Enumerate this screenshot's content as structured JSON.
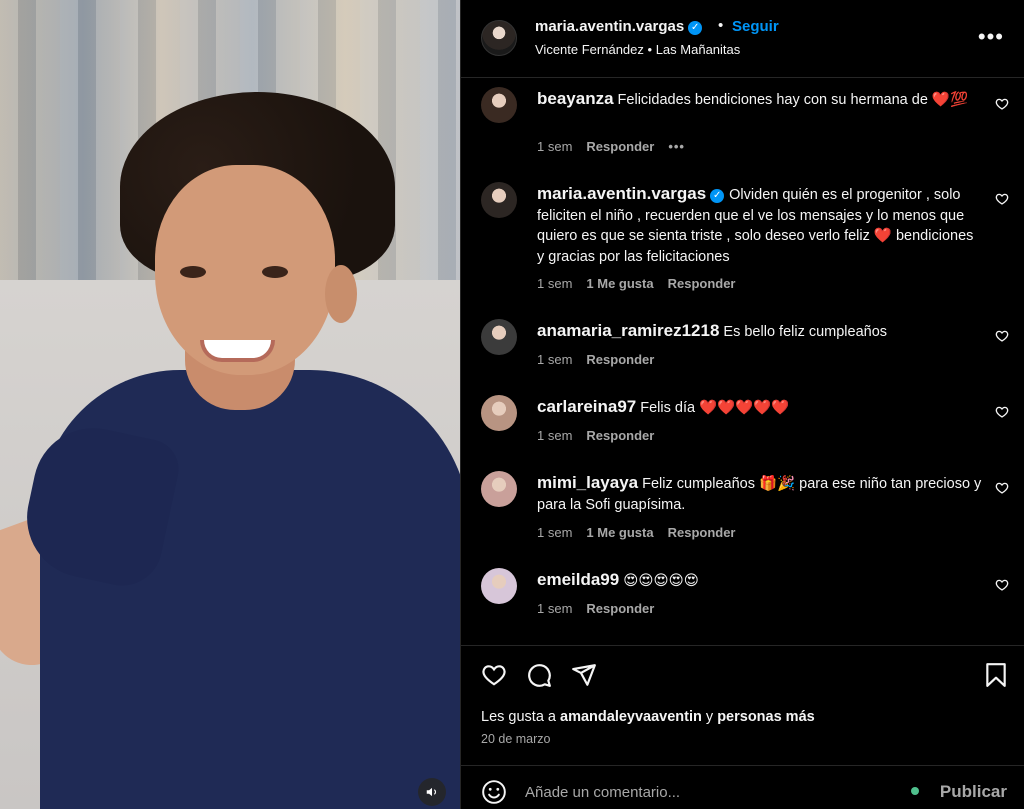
{
  "photo": {
    "sound_icon": "speaker-icon"
  },
  "header": {
    "owner_username": "maria.aventin.vargas",
    "separator": "•",
    "follow_label": "Seguir",
    "audio_artist": "Vicente Fernández",
    "audio_separator": "•",
    "audio_track": "Las Mañanitas",
    "more_icon": "more-options-icon",
    "more_label": "•••"
  },
  "comments": [
    {
      "user": "beayanza",
      "text": "Felicidades bendiciones hay con su hermana de ❤️💯",
      "time": "1 sem",
      "likes": "",
      "reply": "Responder",
      "more": "•••",
      "avatar_color": "#3a2a22"
    },
    {
      "user": "maria.aventin.vargas",
      "verified": true,
      "text": "Olviden quién es el progenitor , solo feliciten el niño , recuerden que el ve los mensajes y lo menos que quiero es que se sienta triste , solo deseo verlo feliz ❤️ bendiciones y gracias por las felicitaciones",
      "time": "1 sem",
      "likes": "1 Me gusta",
      "reply": "Responder",
      "avatar_color": "#2c2623"
    },
    {
      "user": "anamaria_ramirez1218",
      "text": "Es bello feliz cumpleaños",
      "time": "1 sem",
      "likes": "",
      "reply": "Responder",
      "avatar_color": "#3b3b3b"
    },
    {
      "user": "carlareina97",
      "text": "Felis día ❤️❤️❤️❤️❤️",
      "time": "1 sem",
      "likes": "",
      "reply": "Responder",
      "avatar_color": "#b89482"
    },
    {
      "user": "mimi_layaya",
      "text": "Feliz cumpleaños 🎁🎉 para ese niño tan precioso y para la Sofi guapísima.",
      "time": "1 sem",
      "likes": "1 Me gusta",
      "reply": "Responder",
      "avatar_color": "#c9a09a"
    },
    {
      "user": "emeilda99",
      "text": "😍😍😍😍😍",
      "time": "1 sem",
      "likes": "",
      "reply": "Responder",
      "avatar_color": "#d7c6d9"
    }
  ],
  "actions": {
    "like_icon": "heart-icon",
    "comment_icon": "comment-bubble-icon",
    "share_icon": "paper-plane-icon",
    "save_icon": "bookmark-icon",
    "likes_prefix": "Les gusta a",
    "likes_user": "amandaleyvaaventin",
    "likes_middle": "y",
    "likes_suffix": "personas más",
    "date": "20 de marzo"
  },
  "composer": {
    "emoji_icon": "emoji-smiley-icon",
    "placeholder": "Añade un comentario...",
    "publish_label": "Publicar"
  },
  "colors": {
    "accent": "#0095f6",
    "muted": "#a8a8a8",
    "background": "#000000"
  }
}
